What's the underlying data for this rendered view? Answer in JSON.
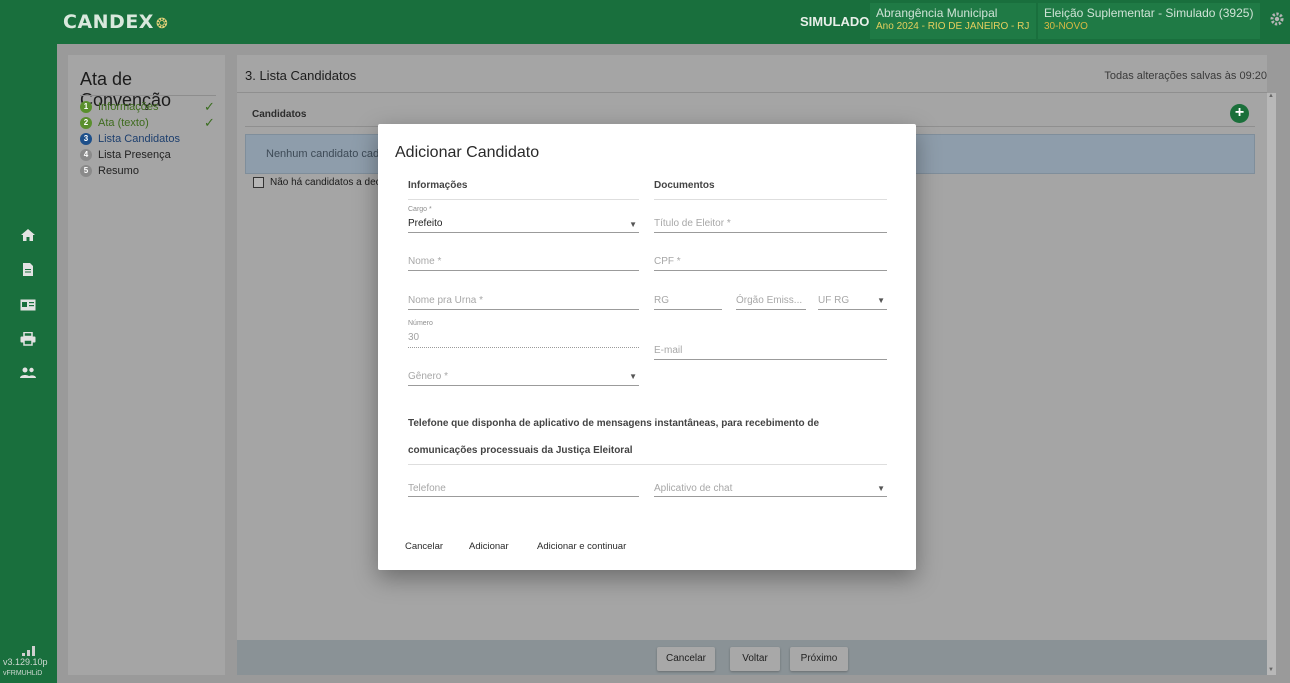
{
  "header": {
    "logo": "CANDEX",
    "mode": "SIMULADO",
    "scope_title": "Abrangência Municipal",
    "scope_detail": "Ano 2024 - RIO DE JANEIRO - RJ",
    "election_title": "Eleição Suplementar - Simulado (3925)",
    "election_detail": "30-NOVO",
    "colors": {
      "topbar": "#196f3d",
      "accent": "#1a6f3a"
    }
  },
  "rail": {
    "icons": [
      "home-icon",
      "document-icon",
      "id-card-icon",
      "printer-icon",
      "users-icon"
    ],
    "version": "v3.129.10p",
    "build": "vFRMUHLiD"
  },
  "sidebar": {
    "title": "Ata de Convenção",
    "steps": [
      {
        "num": "1",
        "label": "Informações",
        "done": true,
        "status": "complete"
      },
      {
        "num": "2",
        "label": "Ata (texto)",
        "done": true,
        "status": "complete"
      },
      {
        "num": "3",
        "label": "Lista Candidatos",
        "done": false,
        "status": "current"
      },
      {
        "num": "4",
        "label": "Lista Presença",
        "done": false,
        "status": "pending"
      },
      {
        "num": "5",
        "label": "Resumo",
        "done": false,
        "status": "pending"
      }
    ]
  },
  "main": {
    "heading": "3. Lista Candidatos",
    "saved": "Todas alterações salvas às 09:20",
    "section": "Candidatos",
    "empty_text": "Nenhum candidato cad",
    "checkbox_label": "Não há candidatos a decla"
  },
  "footer": {
    "cancel": "Cancelar",
    "back": "Voltar",
    "next": "Próximo"
  },
  "dialog": {
    "title": "Adicionar Candidato",
    "info_header": "Informações",
    "docs_header": "Documentos",
    "cargo_label": "Cargo *",
    "cargo_value": "Prefeito",
    "titulo_placeholder": "Título de Eleitor *",
    "nome_placeholder": "Nome *",
    "cpf_placeholder": "CPF *",
    "urna_placeholder": "Nome pra Urna *",
    "rg_placeholder": "RG",
    "orgao_placeholder": "Órgão Emiss...",
    "ufrg_placeholder": "UF RG",
    "numero_label": "Número",
    "numero_value": "30",
    "email_placeholder": "E-mail",
    "genero_placeholder": "Gênero *",
    "phone_header_1": "Telefone que disponha de aplicativo de mensagens instantâneas, para recebimento de",
    "phone_header_2": "comunicações processuais da Justiça Eleitoral",
    "telefone_placeholder": "Telefone",
    "chat_placeholder": "Aplicativo de chat",
    "btn_cancel": "Cancelar",
    "btn_add": "Adicionar",
    "btn_add_continue": "Adicionar e continuar"
  }
}
